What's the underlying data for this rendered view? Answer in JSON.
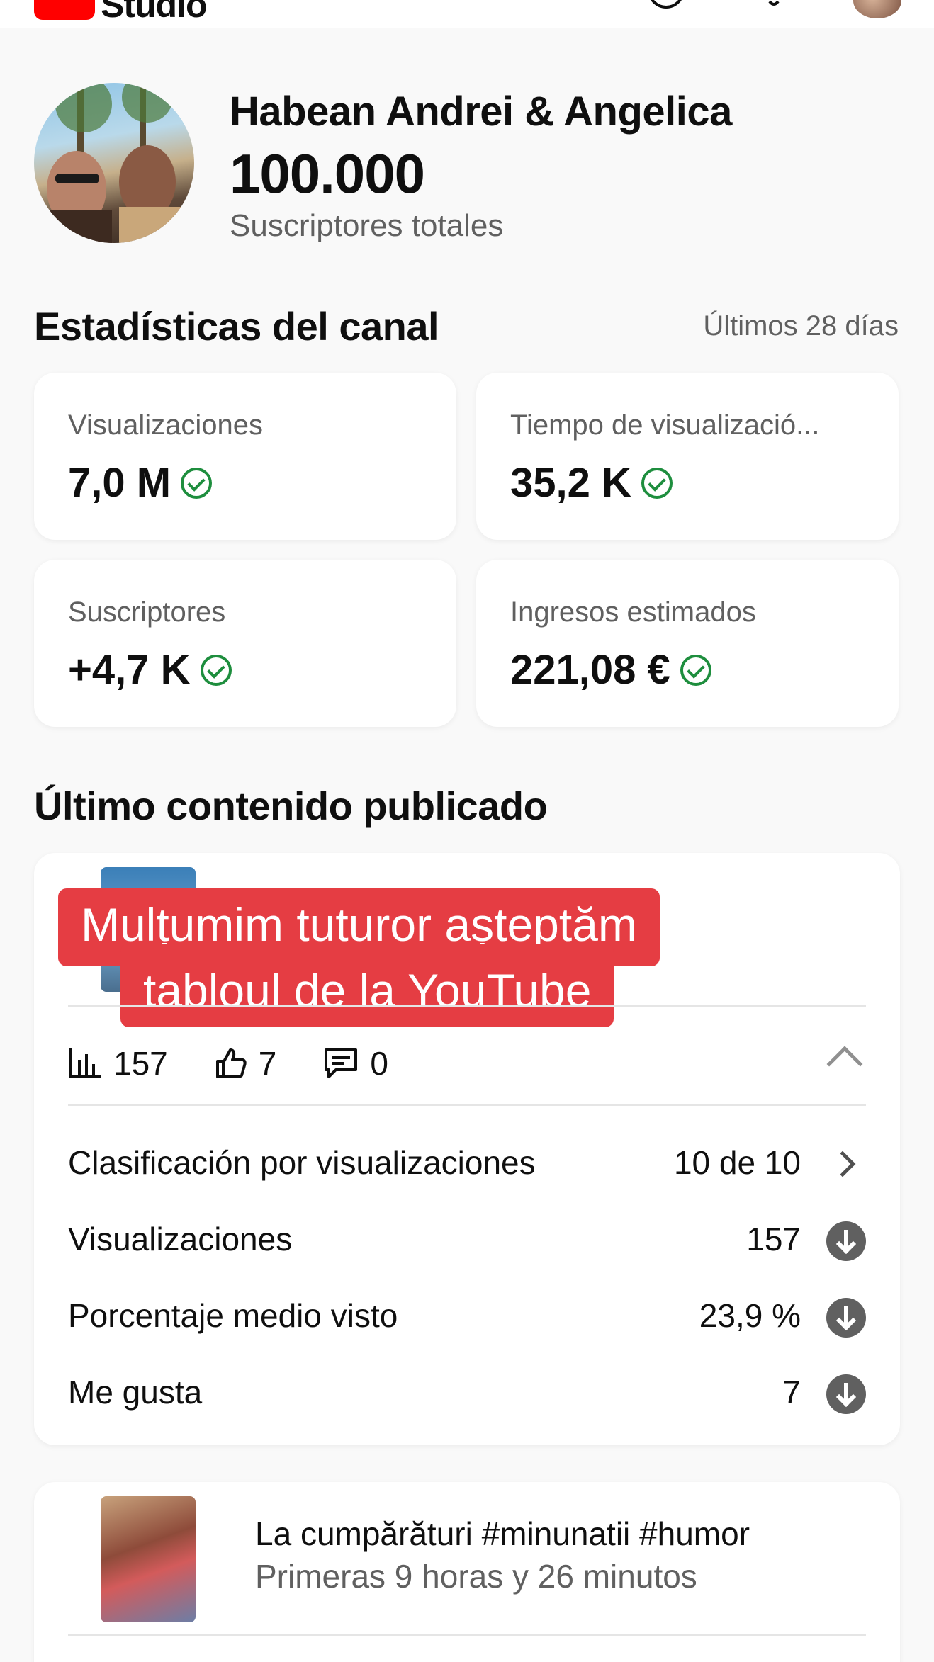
{
  "header": {
    "logo_text": "Studio",
    "icons": [
      "help-icon",
      "bell-icon",
      "account-avatar"
    ]
  },
  "profile": {
    "channel_name": "Habean Andrei & Angelica",
    "subscriber_count": "100.000",
    "subscriber_label": "Suscriptores totales"
  },
  "stats": {
    "title": "Estadísticas del canal",
    "period": "Últimos 28 días",
    "cards": [
      {
        "label": "Visualizaciones",
        "value": "7,0 M"
      },
      {
        "label": "Tiempo de visualizació...",
        "value": "35,2 K"
      },
      {
        "label": "Suscriptores",
        "value": "+4,7 K"
      },
      {
        "label": "Ingresos estimados",
        "value": "221,08 €"
      }
    ],
    "status_color": "#1e8e3e"
  },
  "latest": {
    "title": "Último contenido publicado",
    "overlay_line1": "Mulțumim tuturor așteptăm",
    "overlay_line2": "tabloul de la YouTube",
    "overlay_color": "#e53d43",
    "metrics": {
      "views": "157",
      "likes": "7",
      "comments": "0"
    },
    "details": [
      {
        "label": "Clasificación por visualizaciones",
        "value": "10 de 10"
      },
      {
        "label": "Visualizaciones",
        "value": "157"
      },
      {
        "label": "Porcentaje medio visto",
        "value": "23,9 %"
      },
      {
        "label": "Me gusta",
        "value": "7"
      }
    ]
  },
  "second_video": {
    "title": "La cumpărături #minunatii #humor",
    "subtitle": "Primeras 9 horas y 26 minutos"
  }
}
